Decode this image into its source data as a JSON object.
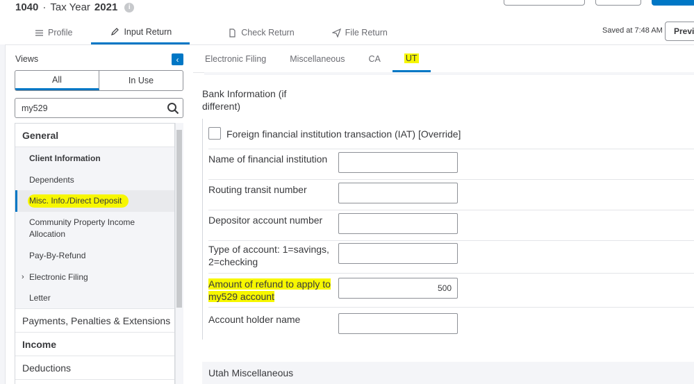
{
  "header": {
    "form": "1040",
    "separator": "·",
    "tax_year_label": "Tax Year",
    "tax_year": "2021",
    "info": "i",
    "saved": "Saved at 7:48 AM",
    "preview": "Previ"
  },
  "main_tabs": [
    {
      "label": "Profile",
      "icon": "list-icon"
    },
    {
      "label": "Input Return",
      "icon": "pencil-icon",
      "active": true
    },
    {
      "label": "Check Return",
      "icon": "document-icon"
    },
    {
      "label": "File Return",
      "icon": "paper-plane-icon"
    }
  ],
  "sidebar": {
    "views_label": "Views",
    "collapse": "‹",
    "seg_all": "All",
    "seg_inuse": "In Use",
    "search_value": "my529",
    "general": "General",
    "items": [
      {
        "label": "Client Information"
      },
      {
        "label": "Dependents"
      },
      {
        "label": "Misc. Info./Direct Deposit"
      },
      {
        "label": "Community Property Income Allocation"
      },
      {
        "label": "Pay-By-Refund"
      },
      {
        "label": "Electronic Filing"
      },
      {
        "label": "Letter"
      }
    ],
    "chevron": "›",
    "groups": [
      {
        "label": "Payments, Penalties & Extensions"
      },
      {
        "label": "Income"
      },
      {
        "label": "Deductions"
      }
    ]
  },
  "sub_tabs": [
    {
      "label": "Electronic Filing"
    },
    {
      "label": "Miscellaneous"
    },
    {
      "label": "CA"
    },
    {
      "label": "UT",
      "active": true
    }
  ],
  "form": {
    "section_title": "Bank Information (if different)",
    "checkbox_label": "Foreign financial institution transaction (IAT) [Override]",
    "fields": [
      {
        "label": "Name of financial institution",
        "value": ""
      },
      {
        "label": "Routing transit number",
        "value": ""
      },
      {
        "label": "Depositor account number",
        "value": ""
      },
      {
        "label": "Type of account: 1=savings, 2=checking",
        "value": ""
      },
      {
        "label": "Amount of refund to apply to my529 account",
        "value": "500"
      },
      {
        "label": "Account holder name",
        "value": ""
      }
    ],
    "next_section": "Utah Miscellaneous"
  },
  "colors": {
    "accent": "#0077c5",
    "highlight": "#f7f700"
  }
}
